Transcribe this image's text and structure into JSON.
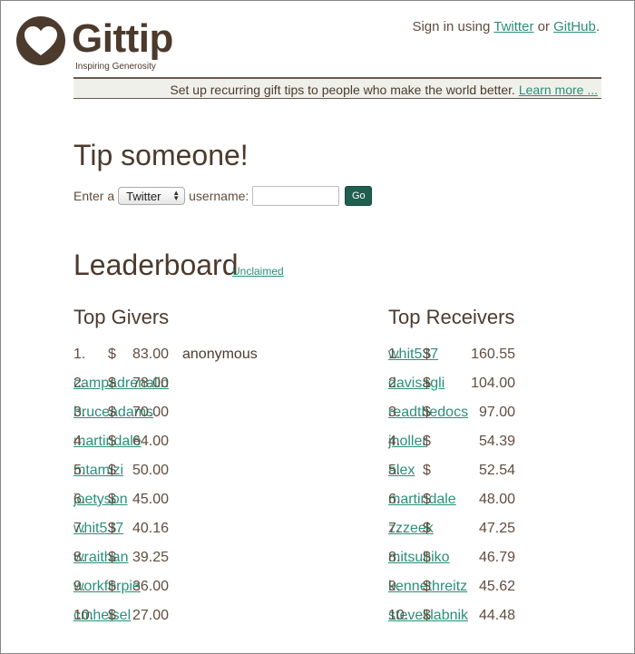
{
  "header": {
    "logo_text": "Gittip",
    "tagline": "Inspiring Generosity",
    "signin_prefix": "Sign in using",
    "twitter_label": "Twitter",
    "or_text": "or",
    "github_label": "GitHub",
    "period": "."
  },
  "banner": {
    "text": "Set up recurring gift tips to people who make the world better.",
    "learn_more": "Learn more ..."
  },
  "tip": {
    "heading": "Tip someone!",
    "enter_a": "Enter a",
    "platform_selected": "Twitter",
    "username_label": "username:",
    "username_value": "",
    "go_label": "Go"
  },
  "leaderboard": {
    "heading": "Leaderboard",
    "unclaimed_label": "Unclaimed",
    "givers_heading": "Top Givers",
    "receivers_heading": "Top Receivers",
    "currency": "$",
    "givers": [
      {
        "rank": "1.",
        "amount": "83.00",
        "name": "anonymous",
        "link": false
      },
      {
        "rank": "2.",
        "amount": "78.00",
        "name": "campadrenalin",
        "link": true
      },
      {
        "rank": "3.",
        "amount": "70.00",
        "name": "bruceadams",
        "link": true
      },
      {
        "rank": "4.",
        "amount": "64.00",
        "name": "martindale",
        "link": true
      },
      {
        "rank": "5.",
        "amount": "50.00",
        "name": "mtamizi",
        "link": true
      },
      {
        "rank": "6.",
        "amount": "45.00",
        "name": "joetyson",
        "link": true
      },
      {
        "rank": "7.",
        "amount": "40.16",
        "name": "whit537",
        "link": true
      },
      {
        "rank": "8.",
        "amount": "39.25",
        "name": "wraithan",
        "link": true
      },
      {
        "rank": "9.",
        "amount": "36.00",
        "name": "workforpie",
        "link": true
      },
      {
        "rank": "10.",
        "amount": "27.00",
        "name": "cmheisel",
        "link": true
      }
    ],
    "receivers": [
      {
        "rank": "1.",
        "amount": "160.55",
        "name": "whit537",
        "link": true
      },
      {
        "rank": "2.",
        "amount": "104.00",
        "name": "davisagli",
        "link": true
      },
      {
        "rank": "3.",
        "amount": "97.00",
        "name": "readthedocs",
        "link": true
      },
      {
        "rank": "4.",
        "amount": "54.39",
        "name": "jnoller",
        "link": true
      },
      {
        "rank": "5.",
        "amount": "52.54",
        "name": "alex",
        "link": true
      },
      {
        "rank": "6.",
        "amount": "48.00",
        "name": "martindale",
        "link": true
      },
      {
        "rank": "7.",
        "amount": "47.25",
        "name": "zzzeek",
        "link": true
      },
      {
        "rank": "8.",
        "amount": "46.79",
        "name": "mitsuhiko",
        "link": true
      },
      {
        "rank": "9.",
        "amount": "45.62",
        "name": "kennethreitz",
        "link": true
      },
      {
        "rank": "10.",
        "amount": "44.48",
        "name": "steveklabnik",
        "link": true
      }
    ]
  },
  "colors": {
    "brand_brown": "#4c3a2d",
    "text_brown": "#614c3e",
    "link_green": "#2a8f79",
    "button_green": "#1f5f4f",
    "banner_bg": "#f0f0ea"
  },
  "icons": {
    "logo": "heart-in-circle-icon",
    "select_arrows": "up-down-arrows-icon"
  }
}
